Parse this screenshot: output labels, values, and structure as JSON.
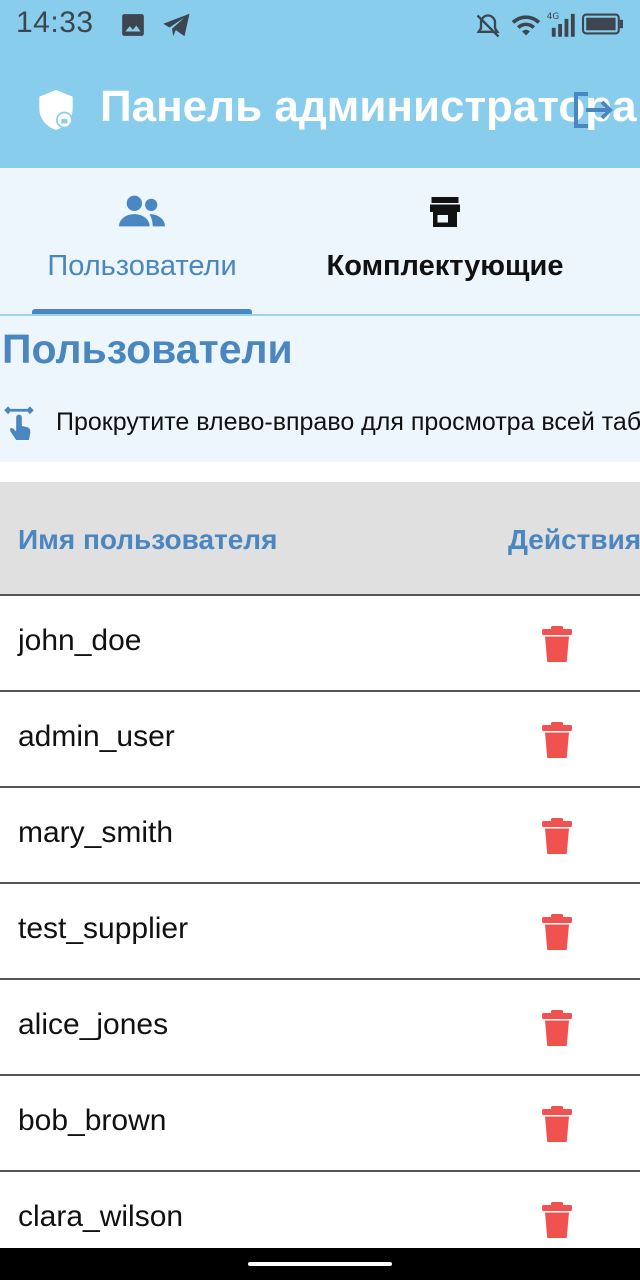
{
  "status_bar": {
    "time": "14:33",
    "icons": [
      "gallery-icon",
      "telegram-icon",
      "mute-icon",
      "wifi-icon",
      "signal-4g-icon",
      "battery-icon"
    ],
    "network": "4G"
  },
  "app_bar": {
    "title": "Панель администратора",
    "leading_icon": "admin-shield-icon",
    "action_icon": "logout-icon"
  },
  "tabs": [
    {
      "label": "Пользователи",
      "icon": "people-icon",
      "selected": true
    },
    {
      "label": "Комплектующие",
      "icon": "store-icon",
      "selected": false
    }
  ],
  "section": {
    "title": "Пользователи",
    "hint_icon": "swipe-icon",
    "hint": "Прокрутите влево-вправо для просмотра всей таблицы"
  },
  "table": {
    "columns": [
      "Имя пользователя",
      "Действия"
    ],
    "rows": [
      {
        "username": "john_doe"
      },
      {
        "username": "admin_user"
      },
      {
        "username": "mary_smith"
      },
      {
        "username": "test_supplier"
      },
      {
        "username": "alice_jones"
      },
      {
        "username": "bob_brown"
      },
      {
        "username": "clara_wilson"
      }
    ],
    "row_action_icon": "delete-icon"
  },
  "colors": {
    "app_bar": "#89cdec",
    "accent": "#4a86c0",
    "panel_background": "#eef6fd",
    "header_background": "#e0e0e0",
    "delete": "#ef5350"
  }
}
